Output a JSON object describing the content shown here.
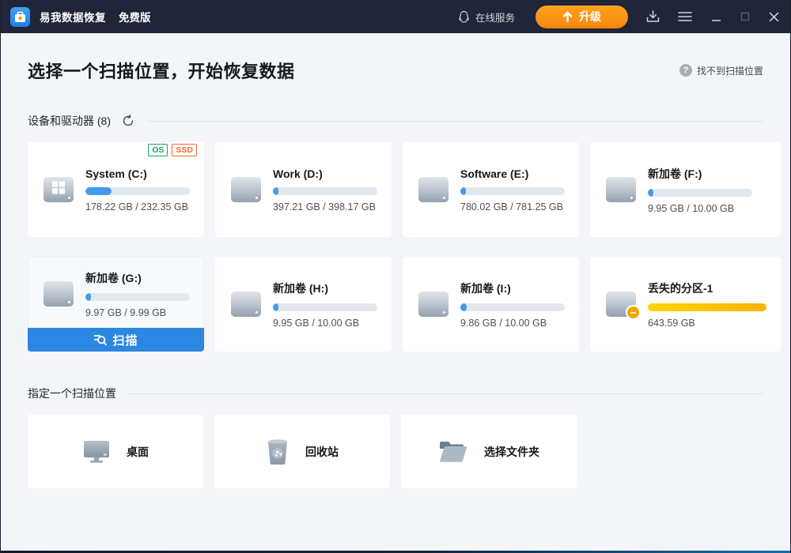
{
  "titlebar": {
    "app_title": "易我数据恢复",
    "edition": "免费版",
    "online_service": "在线服务",
    "upgrade_label": "升级"
  },
  "header": {
    "title": "选择一个扫描位置，开始恢复数据",
    "help_link": "找不到扫描位置",
    "help_mark": "?"
  },
  "sections": {
    "devices_title": "设备和驱动器 (8)",
    "locations_title": "指定一个扫描位置"
  },
  "drives": [
    {
      "name": "System (C:)",
      "capacity": "178.22 GB / 232.35 GB",
      "used_percent": 25,
      "badges": {
        "os": "OS",
        "ssd": "SSD"
      }
    },
    {
      "name": "Work (D:)",
      "capacity": "397.21 GB / 398.17 GB",
      "used_percent": 5
    },
    {
      "name": "Software (E:)",
      "capacity": "780.02 GB / 781.25 GB",
      "used_percent": 5
    },
    {
      "name": "新加卷 (F:)",
      "capacity": "9.95 GB / 10.00 GB",
      "used_percent": 5
    },
    {
      "name": "新加卷 (G:)",
      "capacity": "9.97 GB / 9.99 GB",
      "used_percent": 5,
      "selected": true
    },
    {
      "name": "新加卷 (H:)",
      "capacity": "9.95 GB / 10.00 GB",
      "used_percent": 5
    },
    {
      "name": "新加卷 (I:)",
      "capacity": "9.86 GB / 10.00 GB",
      "used_percent": 6
    },
    {
      "name": "丢失的分区-1",
      "capacity": "643.59 GB",
      "used_percent": 100,
      "lost": true
    }
  ],
  "scan_button": {
    "label": "扫描"
  },
  "locations": [
    {
      "label": "桌面"
    },
    {
      "label": "回收站"
    },
    {
      "label": "选择文件夹"
    }
  ],
  "colors": {
    "titlebar": "#202539",
    "accent_blue": "#2b87e2",
    "bar_fill_blue": "#469bee",
    "bar_fill_yellow": "#ffc400",
    "upgrade_orange": "#f7860d",
    "badge_green": "#1ea362",
    "badge_orange": "#f26a35",
    "background": "#f3f5f9"
  }
}
